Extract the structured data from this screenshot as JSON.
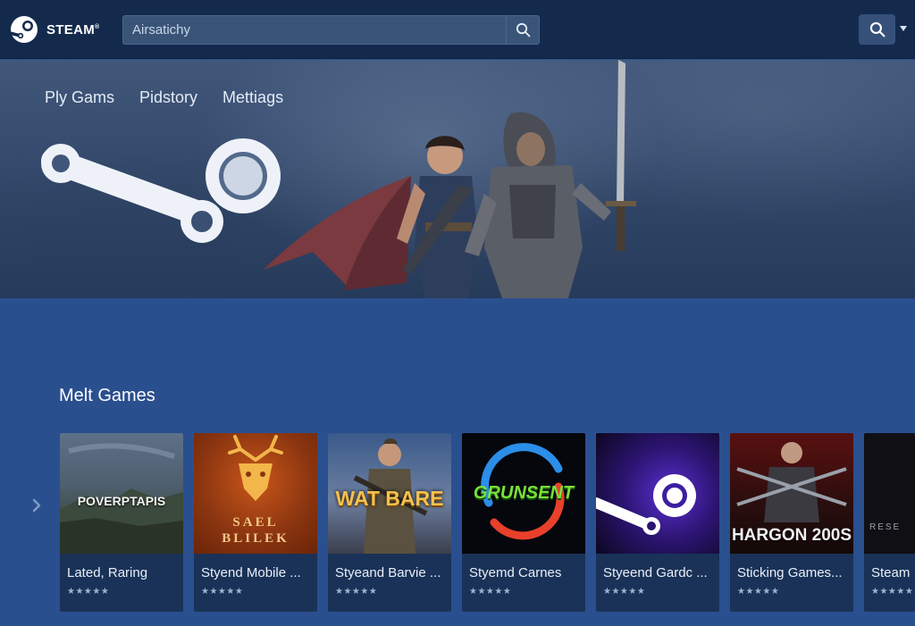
{
  "header": {
    "brand": "STEAM",
    "brand_mark": "®",
    "search_placeholder": "Airsatichy"
  },
  "hero": {
    "nav": [
      "Ply Gams",
      "Pidstory",
      "Mettiags"
    ]
  },
  "section": {
    "title": "Melt Games"
  },
  "cards": [
    {
      "title": "Lated, Raring",
      "stars": "★★★★★",
      "thumb_text": "POVERPTAPIS"
    },
    {
      "title": "Styend Mobile ...",
      "stars": "★★★★★",
      "thumb_text_1": "SAEL",
      "thumb_text_2": "BLILEK"
    },
    {
      "title": "Styeand Barvie ...",
      "stars": "★★★★★",
      "thumb_text": "WAT BARE"
    },
    {
      "title": "Styemd Carnes",
      "stars": "★★★★★",
      "thumb_text": "GRUNSENT"
    },
    {
      "title": "Styeend Gardc ...",
      "stars": "★★★★★"
    },
    {
      "title": "Sticking Games...",
      "stars": "★★★★★",
      "thumb_text": "HARGON 200S"
    },
    {
      "title": "Steam",
      "stars": "★★★★★",
      "thumb_text": "RESE"
    }
  ],
  "colors": {
    "topbar": "#142a4d",
    "page_bg": "#2a4f8f",
    "card_bg": "#1a3257",
    "search_bg": "#3a5478"
  },
  "icons": {
    "brand": "steam-logo-icon",
    "search": "search-icon",
    "caret": "caret-down-icon",
    "carousel_prev": "chevron-right-icon"
  }
}
